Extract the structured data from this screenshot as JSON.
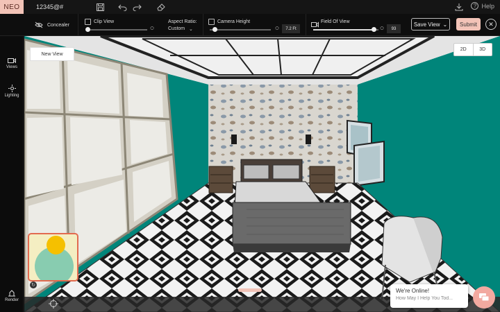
{
  "app": {
    "brand": "NEO",
    "project_name": "12345@#"
  },
  "topbar": {
    "icons": [
      "save-icon",
      "undo-icon",
      "redo-icon",
      "eraser-icon",
      "download-icon",
      "help-icon"
    ],
    "help_label": "Help"
  },
  "toolbar": {
    "concealer_label": "Concealer",
    "clip_view_label": "Clip View",
    "aspect_ratio_label": "Aspect Ratio:",
    "aspect_ratio_value": "Custom",
    "camera_height_label": "Camera Height",
    "camera_height_value": "7.2 Ft",
    "field_of_view_label": "Field Of View",
    "field_of_view_value": "93",
    "clip_view_level": 0.02,
    "camera_height_level": 0.08,
    "field_of_view_level": 0.93,
    "save_view_label": "Save View",
    "submit_label": "Submit"
  },
  "sidebar": {
    "items": [
      {
        "label": "Views",
        "icon": "camera-icon"
      },
      {
        "label": "Lighting",
        "icon": "sun-icon"
      }
    ],
    "render_label": "Render"
  },
  "viewport": {
    "view_tab": "New View",
    "mode_2d": "2D",
    "mode_3d": "3D"
  },
  "chat": {
    "title": "We're Online!",
    "subtitle": "How May I Help You Tod..."
  },
  "colors": {
    "accent": "#f2c3b7",
    "wall_teal": "#00857a",
    "minimap_border": "#e26a4f",
    "minimap_sun": "#f5c000",
    "minimap_circle": "#88ccb0"
  }
}
